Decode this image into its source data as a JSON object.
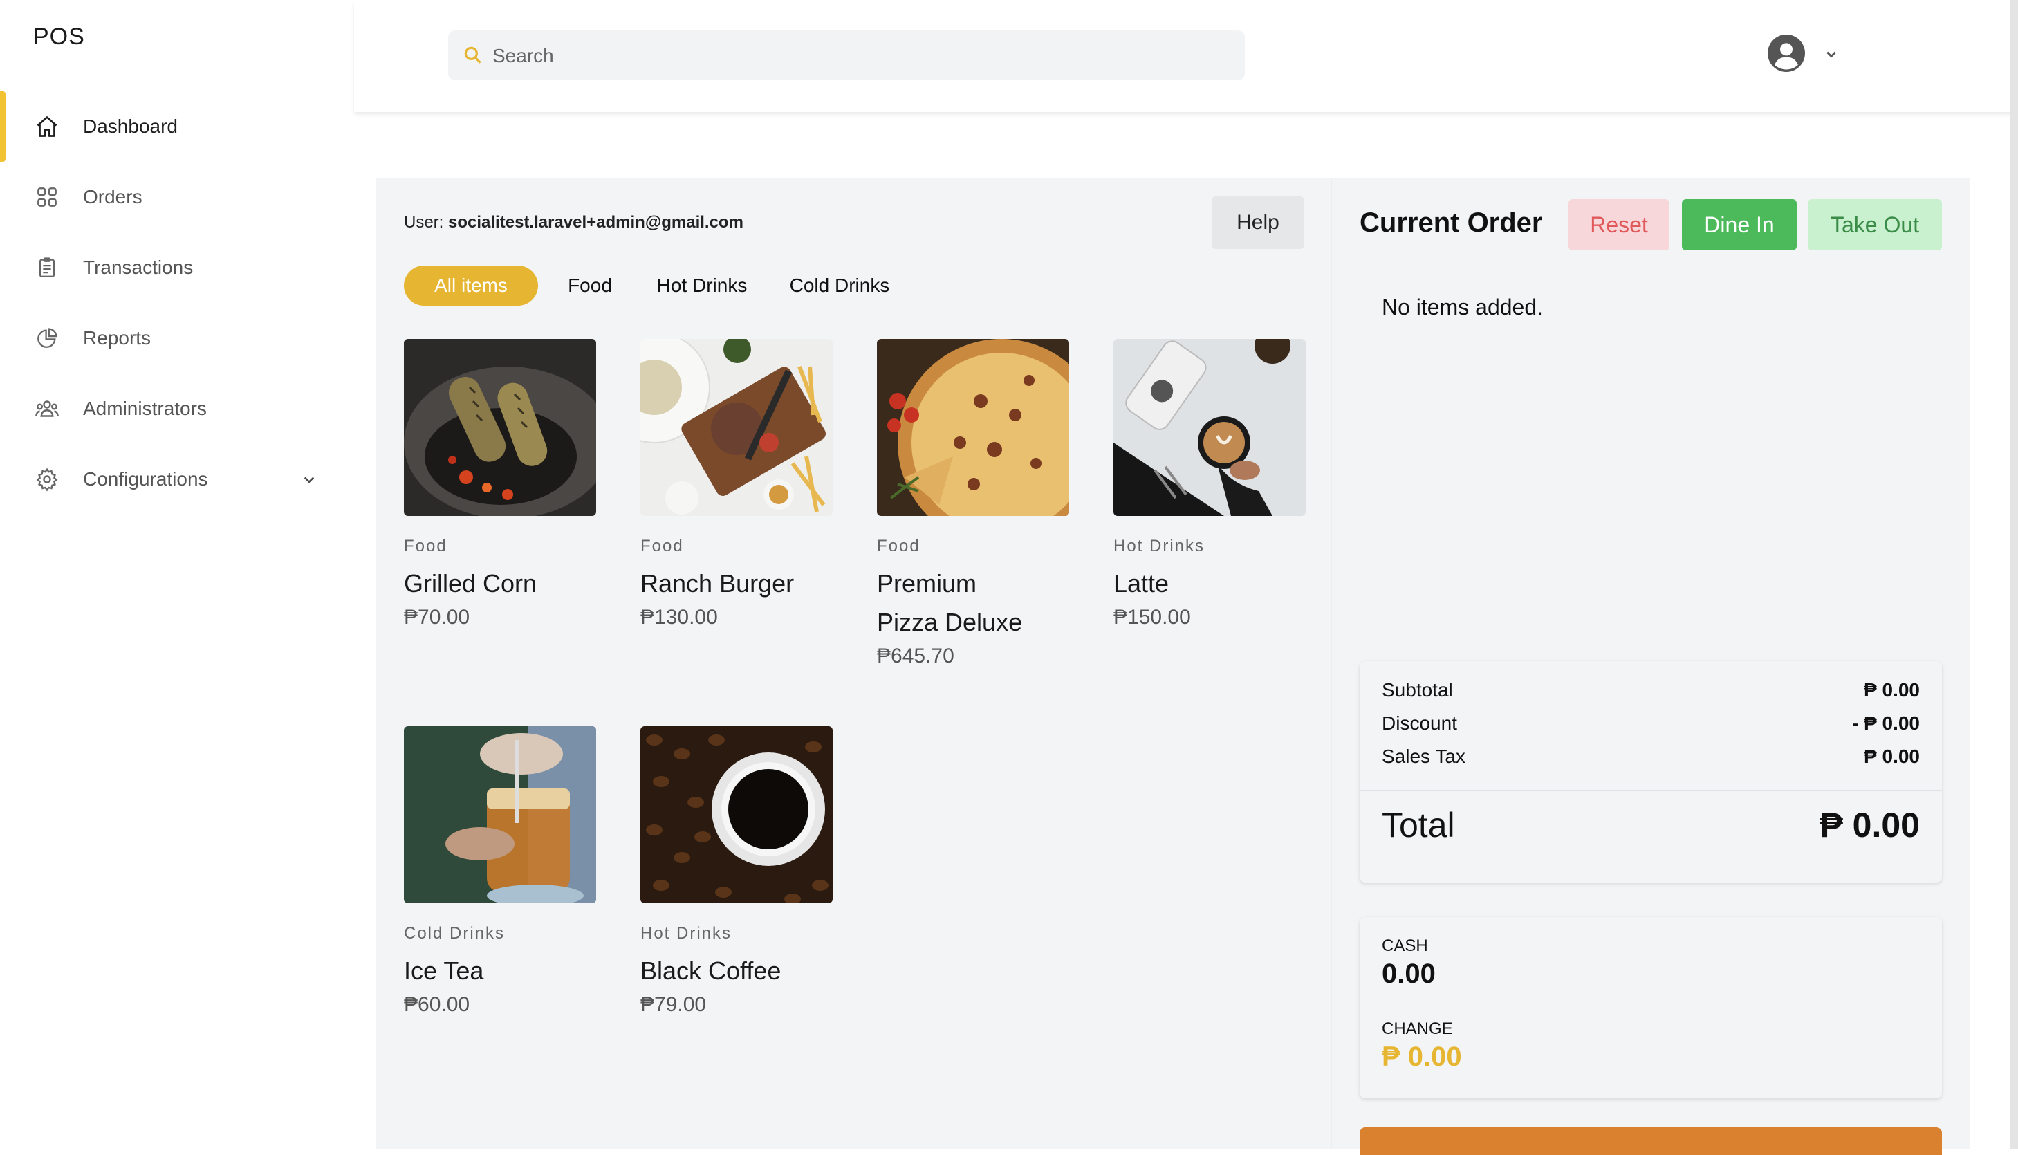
{
  "app": {
    "logo": "POS"
  },
  "sidebar": {
    "items": [
      {
        "label": "Dashboard",
        "icon": "home-icon",
        "active": true
      },
      {
        "label": "Orders",
        "icon": "grid-icon"
      },
      {
        "label": "Transactions",
        "icon": "clipboard-icon"
      },
      {
        "label": "Reports",
        "icon": "pie-chart-icon"
      },
      {
        "label": "Administrators",
        "icon": "users-icon"
      },
      {
        "label": "Configurations",
        "icon": "gear-icon",
        "has_submenu": true
      }
    ]
  },
  "header": {
    "search_placeholder": "Search",
    "search_value": ""
  },
  "main": {
    "user_prefix": "User:",
    "user_email": "socialitest.laravel+admin@gmail.com",
    "help_label": "Help",
    "tabs": [
      {
        "label": "All items",
        "active": true
      },
      {
        "label": "Food"
      },
      {
        "label": "Hot Drinks"
      },
      {
        "label": "Cold Drinks"
      }
    ],
    "products": [
      {
        "category": "Food",
        "name": "Grilled Corn",
        "price": "₱70.00"
      },
      {
        "category": "Food",
        "name": "Ranch Burger",
        "price": "₱130.00"
      },
      {
        "category": "Food",
        "name": "Premium Pizza Deluxe",
        "price": "₱645.70"
      },
      {
        "category": "Hot Drinks",
        "name": "Latte",
        "price": "₱150.00"
      },
      {
        "category": "Cold Drinks",
        "name": "Ice Tea",
        "price": "₱60.00"
      },
      {
        "category": "Hot Drinks",
        "name": "Black Coffee",
        "price": "₱79.00"
      }
    ]
  },
  "order": {
    "title": "Current Order",
    "reset_label": "Reset",
    "dine_in_label": "Dine In",
    "take_out_label": "Take Out",
    "empty_text": "No items added.",
    "subtotal_label": "Subtotal",
    "subtotal_value": "₱ 0.00",
    "discount_label": "Discount",
    "discount_value": "- ₱ 0.00",
    "tax_label": "Sales Tax",
    "tax_value": "₱ 0.00",
    "total_label": "Total",
    "total_value": "₱ 0.00",
    "cash_label": "CASH",
    "cash_value": "0.00",
    "change_label": "CHANGE",
    "change_value": "₱ 0.00"
  },
  "colors": {
    "accent": "#f1c232",
    "tab_active": "#e6b531",
    "dine_in": "#4cba5b",
    "reset_text": "#e0595a",
    "change": "#e6b531",
    "pay_button": "#d9812f"
  }
}
